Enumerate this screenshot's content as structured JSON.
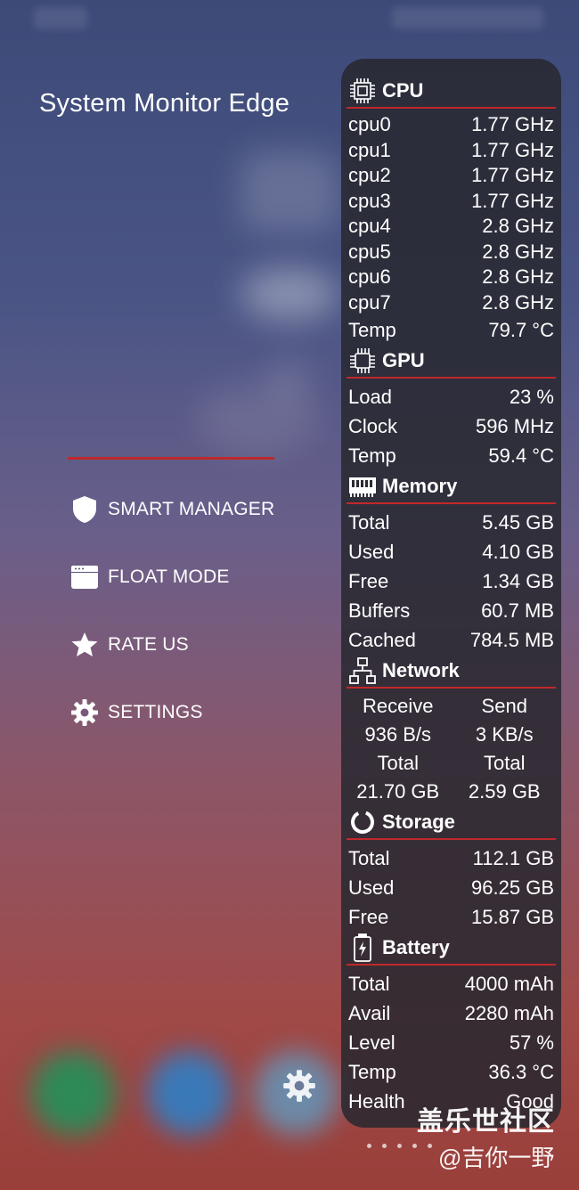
{
  "app": {
    "title": "System Monitor Edge"
  },
  "menu": [
    {
      "label": "SMART MANAGER",
      "icon": "shield-icon"
    },
    {
      "label": "FLOAT MODE",
      "icon": "window-icon"
    },
    {
      "label": "RATE US",
      "icon": "star-icon"
    },
    {
      "label": "SETTINGS",
      "icon": "gear-icon"
    }
  ],
  "accent_color": "#c0282a",
  "panel": {
    "cpu": {
      "title": "CPU",
      "rows": [
        {
          "label": "cpu0",
          "value": "1.77 GHz"
        },
        {
          "label": "cpu1",
          "value": "1.77 GHz"
        },
        {
          "label": "cpu2",
          "value": "1.77 GHz"
        },
        {
          "label": "cpu3",
          "value": "1.77 GHz"
        },
        {
          "label": "cpu4",
          "value": "2.8 GHz"
        },
        {
          "label": "cpu5",
          "value": "2.8 GHz"
        },
        {
          "label": "cpu6",
          "value": "2.8 GHz"
        },
        {
          "label": "cpu7",
          "value": "2.8 GHz"
        }
      ],
      "temp_label": "Temp",
      "temp_value": "79.7 °C"
    },
    "gpu": {
      "title": "GPU",
      "rows": [
        {
          "label": "Load",
          "value": "23 %"
        },
        {
          "label": "Clock",
          "value": "596 MHz"
        },
        {
          "label": "Temp",
          "value": "59.4 °C"
        }
      ]
    },
    "memory": {
      "title": "Memory",
      "rows": [
        {
          "label": "Total",
          "value": "5.45 GB"
        },
        {
          "label": "Used",
          "value": "4.10 GB"
        },
        {
          "label": "Free",
          "value": "1.34 GB"
        },
        {
          "label": "Buffers",
          "value": "60.7 MB"
        },
        {
          "label": "Cached",
          "value": "784.5 MB"
        }
      ]
    },
    "network": {
      "title": "Network",
      "receive_label": "Receive",
      "send_label": "Send",
      "receive_rate": "936 B/s",
      "send_rate": "3 KB/s",
      "total_label": "Total",
      "receive_total": "21.70 GB",
      "send_total": "2.59 GB"
    },
    "storage": {
      "title": "Storage",
      "rows": [
        {
          "label": "Total",
          "value": "112.1 GB"
        },
        {
          "label": "Used",
          "value": "96.25 GB"
        },
        {
          "label": "Free",
          "value": "15.87 GB"
        }
      ]
    },
    "battery": {
      "title": "Battery",
      "rows": [
        {
          "label": "Total",
          "value": "4000 mAh"
        },
        {
          "label": "Avail",
          "value": "2280 mAh"
        },
        {
          "label": "Level",
          "value": "57 %"
        },
        {
          "label": "Temp",
          "value": "36.3 °C"
        },
        {
          "label": "Health",
          "value": "Good"
        }
      ]
    }
  },
  "watermark": {
    "line1": "盖乐世社区",
    "line2": "@吉你一野"
  }
}
